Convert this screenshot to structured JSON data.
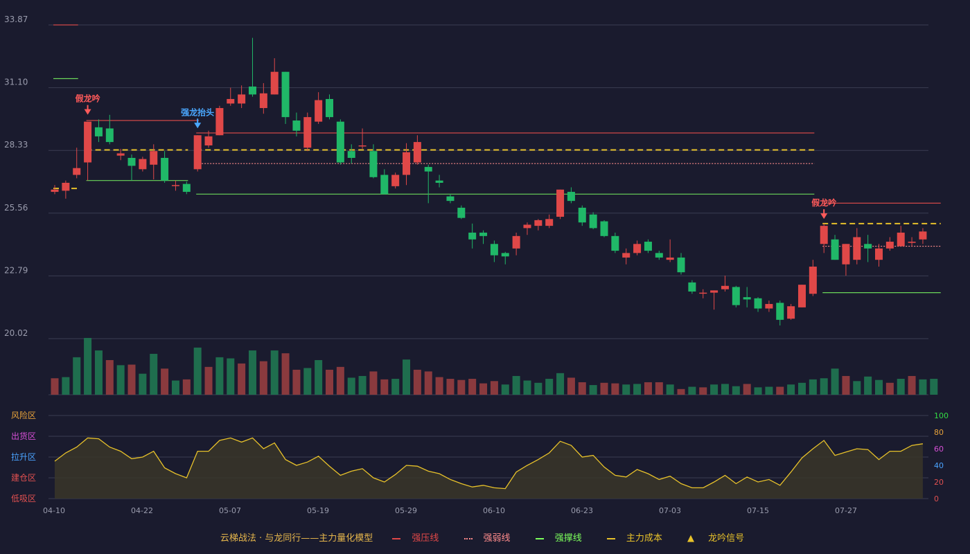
{
  "chart_data": {
    "type": "candlestick",
    "price_axis": {
      "ticks": [
        "33.87",
        "31.10",
        "28.33",
        "25.56",
        "22.79",
        "20.02"
      ],
      "range": [
        20.02,
        33.87
      ]
    },
    "date_ticks": [
      "04-10",
      "04-22",
      "05-07",
      "05-19",
      "05-29",
      "06-10",
      "06-23",
      "07-03",
      "07-15",
      "07-27"
    ],
    "candles": [
      [
        26.5,
        26.6,
        26.8,
        26.4
      ],
      [
        26.55,
        26.9,
        27.0,
        26.2
      ],
      [
        27.25,
        27.55,
        28.45,
        27.1
      ],
      [
        27.8,
        29.6,
        29.6,
        27.0
      ],
      [
        29.35,
        28.95,
        29.7,
        28.7
      ],
      [
        29.3,
        28.7,
        29.9,
        28.6
      ],
      [
        28.1,
        28.2,
        28.4,
        27.9
      ],
      [
        28.0,
        27.65,
        28.15,
        27.0
      ],
      [
        27.5,
        27.95,
        28.05,
        27.4
      ],
      [
        27.7,
        28.3,
        28.6,
        27.05
      ],
      [
        28.0,
        27.0,
        28.3,
        26.9
      ],
      [
        26.8,
        26.8,
        27.0,
        26.55
      ],
      [
        26.85,
        26.5,
        26.95,
        26.4
      ],
      [
        27.5,
        29.0,
        29.0,
        27.4
      ],
      [
        28.55,
        28.95,
        29.2,
        28.45
      ],
      [
        29.0,
        30.2,
        30.3,
        29.0
      ],
      [
        30.4,
        30.6,
        31.1,
        30.3
      ],
      [
        30.4,
        30.8,
        31.2,
        30.2
      ],
      [
        31.15,
        30.8,
        33.3,
        30.7
      ],
      [
        30.2,
        30.85,
        31.3,
        29.95
      ],
      [
        30.8,
        31.8,
        32.4,
        30.8
      ],
      [
        31.8,
        29.8,
        31.8,
        29.5
      ],
      [
        29.65,
        29.2,
        30.0,
        28.95
      ],
      [
        28.45,
        29.8,
        30.0,
        28.3
      ],
      [
        29.6,
        30.55,
        30.9,
        29.5
      ],
      [
        30.6,
        29.8,
        30.8,
        29.7
      ],
      [
        29.6,
        27.8,
        29.7,
        27.7
      ],
      [
        28.3,
        28.0,
        28.6,
        27.75
      ],
      [
        28.55,
        28.55,
        29.3,
        28.4
      ],
      [
        28.3,
        27.15,
        28.6,
        27.1
      ],
      [
        27.25,
        26.4,
        27.5,
        26.4
      ],
      [
        26.75,
        27.25,
        27.35,
        26.65
      ],
      [
        27.25,
        28.25,
        28.65,
        26.8
      ],
      [
        27.8,
        28.7,
        29.0,
        27.7
      ],
      [
        27.6,
        27.4,
        27.7,
        26.0
      ],
      [
        27.0,
        26.9,
        27.25,
        26.7
      ],
      [
        26.3,
        26.1,
        26.4,
        26.0
      ],
      [
        25.8,
        25.35,
        25.9,
        25.3
      ],
      [
        24.7,
        24.4,
        25.1,
        24.0
      ],
      [
        24.7,
        24.55,
        24.8,
        24.2
      ],
      [
        24.2,
        23.7,
        24.35,
        23.4
      ],
      [
        23.8,
        23.65,
        23.85,
        23.3
      ],
      [
        24.0,
        24.55,
        24.7,
        23.7
      ],
      [
        24.9,
        25.05,
        25.15,
        24.6
      ],
      [
        25.0,
        25.25,
        25.3,
        24.8
      ],
      [
        25.0,
        25.3,
        25.5,
        24.9
      ],
      [
        25.4,
        26.6,
        26.6,
        25.3
      ],
      [
        26.5,
        26.1,
        26.7,
        26.0
      ],
      [
        25.8,
        25.15,
        25.9,
        25.0
      ],
      [
        25.5,
        24.9,
        25.6,
        24.85
      ],
      [
        25.2,
        24.55,
        25.25,
        24.5
      ],
      [
        24.55,
        23.9,
        24.7,
        23.8
      ],
      [
        23.6,
        23.8,
        24.0,
        23.3
      ],
      [
        23.8,
        24.2,
        24.35,
        23.7
      ],
      [
        24.3,
        23.9,
        24.4,
        23.8
      ],
      [
        23.8,
        23.6,
        23.9,
        23.5
      ],
      [
        23.5,
        23.6,
        24.4,
        23.4
      ],
      [
        23.6,
        22.95,
        23.8,
        22.85
      ],
      [
        22.5,
        22.1,
        22.6,
        22.0
      ],
      [
        22.05,
        22.05,
        22.2,
        21.8
      ],
      [
        22.05,
        22.15,
        22.15,
        21.3
      ],
      [
        22.2,
        22.35,
        22.8,
        22.1
      ],
      [
        22.3,
        21.5,
        22.35,
        21.4
      ],
      [
        21.85,
        21.75,
        22.3,
        21.4
      ],
      [
        21.8,
        21.35,
        21.85,
        21.2
      ],
      [
        21.35,
        21.55,
        21.7,
        21.2
      ],
      [
        21.6,
        20.85,
        21.7,
        20.6
      ],
      [
        20.9,
        21.45,
        21.55,
        20.85
      ],
      [
        21.4,
        22.4,
        22.4,
        21.4
      ],
      [
        22.0,
        23.2,
        23.5,
        21.9
      ],
      [
        24.2,
        25.0,
        25.1,
        23.8
      ],
      [
        24.4,
        23.5,
        24.6,
        23.5
      ],
      [
        23.3,
        24.2,
        24.2,
        22.8
      ],
      [
        23.5,
        24.5,
        24.9,
        23.3
      ],
      [
        24.2,
        24.0,
        24.6,
        23.4
      ],
      [
        23.5,
        24.0,
        24.2,
        23.2
      ],
      [
        24.0,
        24.3,
        24.5,
        23.9
      ],
      [
        24.1,
        24.7,
        25.0,
        24.1
      ],
      [
        24.25,
        24.3,
        24.5,
        24.1
      ],
      [
        24.4,
        24.75,
        24.9,
        24.2
      ]
    ],
    "volume_bars": [
      [
        0.29,
        "r"
      ],
      [
        0.31,
        "g"
      ],
      [
        0.66,
        "g"
      ],
      [
        1.0,
        "g"
      ],
      [
        0.78,
        "g"
      ],
      [
        0.61,
        "r"
      ],
      [
        0.52,
        "g"
      ],
      [
        0.53,
        "r"
      ],
      [
        0.37,
        "g"
      ],
      [
        0.72,
        "g"
      ],
      [
        0.46,
        "r"
      ],
      [
        0.25,
        "g"
      ],
      [
        0.27,
        "r"
      ],
      [
        0.83,
        "g"
      ],
      [
        0.49,
        "r"
      ],
      [
        0.66,
        "g"
      ],
      [
        0.64,
        "g"
      ],
      [
        0.55,
        "r"
      ],
      [
        0.78,
        "g"
      ],
      [
        0.59,
        "r"
      ],
      [
        0.78,
        "g"
      ],
      [
        0.73,
        "r"
      ],
      [
        0.44,
        "r"
      ],
      [
        0.47,
        "g"
      ],
      [
        0.61,
        "g"
      ],
      [
        0.44,
        "r"
      ],
      [
        0.49,
        "r"
      ],
      [
        0.3,
        "g"
      ],
      [
        0.33,
        "g"
      ],
      [
        0.41,
        "r"
      ],
      [
        0.27,
        "r"
      ],
      [
        0.28,
        "g"
      ],
      [
        0.62,
        "g"
      ],
      [
        0.44,
        "r"
      ],
      [
        0.41,
        "r"
      ],
      [
        0.31,
        "r"
      ],
      [
        0.28,
        "r"
      ],
      [
        0.26,
        "r"
      ],
      [
        0.28,
        "r"
      ],
      [
        0.2,
        "r"
      ],
      [
        0.24,
        "r"
      ],
      [
        0.18,
        "g"
      ],
      [
        0.33,
        "g"
      ],
      [
        0.25,
        "g"
      ],
      [
        0.21,
        "g"
      ],
      [
        0.28,
        "g"
      ],
      [
        0.38,
        "g"
      ],
      [
        0.3,
        "r"
      ],
      [
        0.22,
        "r"
      ],
      [
        0.17,
        "g"
      ],
      [
        0.21,
        "r"
      ],
      [
        0.2,
        "r"
      ],
      [
        0.18,
        "g"
      ],
      [
        0.19,
        "g"
      ],
      [
        0.22,
        "r"
      ],
      [
        0.22,
        "r"
      ],
      [
        0.18,
        "g"
      ],
      [
        0.1,
        "r"
      ],
      [
        0.14,
        "g"
      ],
      [
        0.13,
        "r"
      ],
      [
        0.18,
        "g"
      ],
      [
        0.19,
        "g"
      ],
      [
        0.15,
        "g"
      ],
      [
        0.19,
        "r"
      ],
      [
        0.13,
        "g"
      ],
      [
        0.14,
        "g"
      ],
      [
        0.14,
        "r"
      ],
      [
        0.18,
        "g"
      ],
      [
        0.21,
        "g"
      ],
      [
        0.27,
        "g"
      ],
      [
        0.29,
        "g"
      ],
      [
        0.46,
        "g"
      ],
      [
        0.33,
        "r"
      ],
      [
        0.24,
        "g"
      ],
      [
        0.32,
        "g"
      ],
      [
        0.26,
        "g"
      ],
      [
        0.21,
        "r"
      ],
      [
        0.28,
        "g"
      ],
      [
        0.33,
        "r"
      ],
      [
        0.27,
        "g"
      ],
      [
        0.28,
        "g"
      ]
    ],
    "signals": [
      {
        "label": "假龙吟",
        "index": 3,
        "price": 29.6
      },
      {
        "label": "强龙抬头",
        "index": 13,
        "price": 29.0
      },
      {
        "label": "假龙吟",
        "index": 70,
        "price": 25.0
      }
    ],
    "levels": [
      {
        "type": "pressure",
        "value": 33.87,
        "from": 0,
        "to": 2
      },
      {
        "type": "support",
        "value": 31.5,
        "from": 0,
        "to": 2
      },
      {
        "type": "cost",
        "value": 26.65,
        "from": 0,
        "to": 2
      },
      {
        "type": "pressure",
        "value": 29.65,
        "from": 3,
        "to": 13
      },
      {
        "type": "cost",
        "value": 28.35,
        "from": 3,
        "to": 12
      },
      {
        "type": "support",
        "value": 27.0,
        "from": 3,
        "to": 12
      },
      {
        "type": "pressure",
        "value": 29.1,
        "from": 13,
        "to": 69
      },
      {
        "type": "cost",
        "value": 28.35,
        "from": 13,
        "to": 69
      },
      {
        "type": "weak",
        "value": 27.75,
        "from": 13,
        "to": 69
      },
      {
        "type": "support",
        "value": 26.4,
        "from": 13,
        "to": 69
      },
      {
        "type": "pressure",
        "value": 26.0,
        "from": 70,
        "to": 80.5
      },
      {
        "type": "cost",
        "value": 25.1,
        "from": 70,
        "to": 80.5
      },
      {
        "type": "weak",
        "value": 24.1,
        "from": 70,
        "to": 80.5
      },
      {
        "type": "support",
        "value": 22.05,
        "from": 70,
        "to": 80.5
      }
    ],
    "oscillator": {
      "zone_labels": [
        "风险区",
        "出货区",
        "拉升区",
        "建仓区",
        "低吸区"
      ],
      "zone_colors": [
        "#e7a23a",
        "#d64fd6",
        "#4aa3ff",
        "#e05050",
        "#e05050"
      ],
      "right_ticks": [
        "100",
        "80",
        "60",
        "40",
        "20",
        "0"
      ],
      "right_tick_colors": [
        "#33dd44",
        "#e7a23a",
        "#d64fd6",
        "#4aa3ff",
        "#e05050",
        "#e05050"
      ],
      "range": [
        0,
        100
      ],
      "values": [
        45,
        55,
        62,
        73,
        72,
        62,
        57,
        48,
        50,
        57,
        37,
        30,
        25,
        57,
        57,
        70,
        73,
        68,
        73,
        60,
        67,
        47,
        40,
        44,
        51,
        39,
        28,
        33,
        36,
        25,
        20,
        29,
        40,
        39,
        33,
        30,
        23,
        18,
        14,
        16,
        13,
        12,
        32,
        40,
        47,
        55,
        69,
        64,
        50,
        52,
        38,
        28,
        26,
        35,
        30,
        23,
        27,
        18,
        13,
        13,
        20,
        28,
        18,
        26,
        20,
        23,
        16,
        32,
        49,
        60,
        70,
        52,
        56,
        60,
        59,
        47,
        57,
        57,
        64,
        66
      ]
    },
    "legend": {
      "title": "云梯战法 · 与龙同行——主力量化模型",
      "items": [
        {
          "label": "强压线",
          "color": "#e04848",
          "style": "solid"
        },
        {
          "label": "强弱线",
          "color": "#ff8c8c",
          "style": "dotted"
        },
        {
          "label": "强撑线",
          "color": "#7cff5c",
          "style": "solid"
        },
        {
          "label": "主力成本",
          "color": "#e8c22a",
          "style": "dashed"
        },
        {
          "label": "龙吟信号",
          "color": "#e8c22a",
          "style": "triangle"
        }
      ]
    },
    "colors": {
      "up": "#e04848",
      "down": "#20b868",
      "background": "#1a1b2e",
      "grid": "#3a3c52",
      "axis_text": "#9a9cad",
      "osc_line": "#e8c22a"
    }
  }
}
